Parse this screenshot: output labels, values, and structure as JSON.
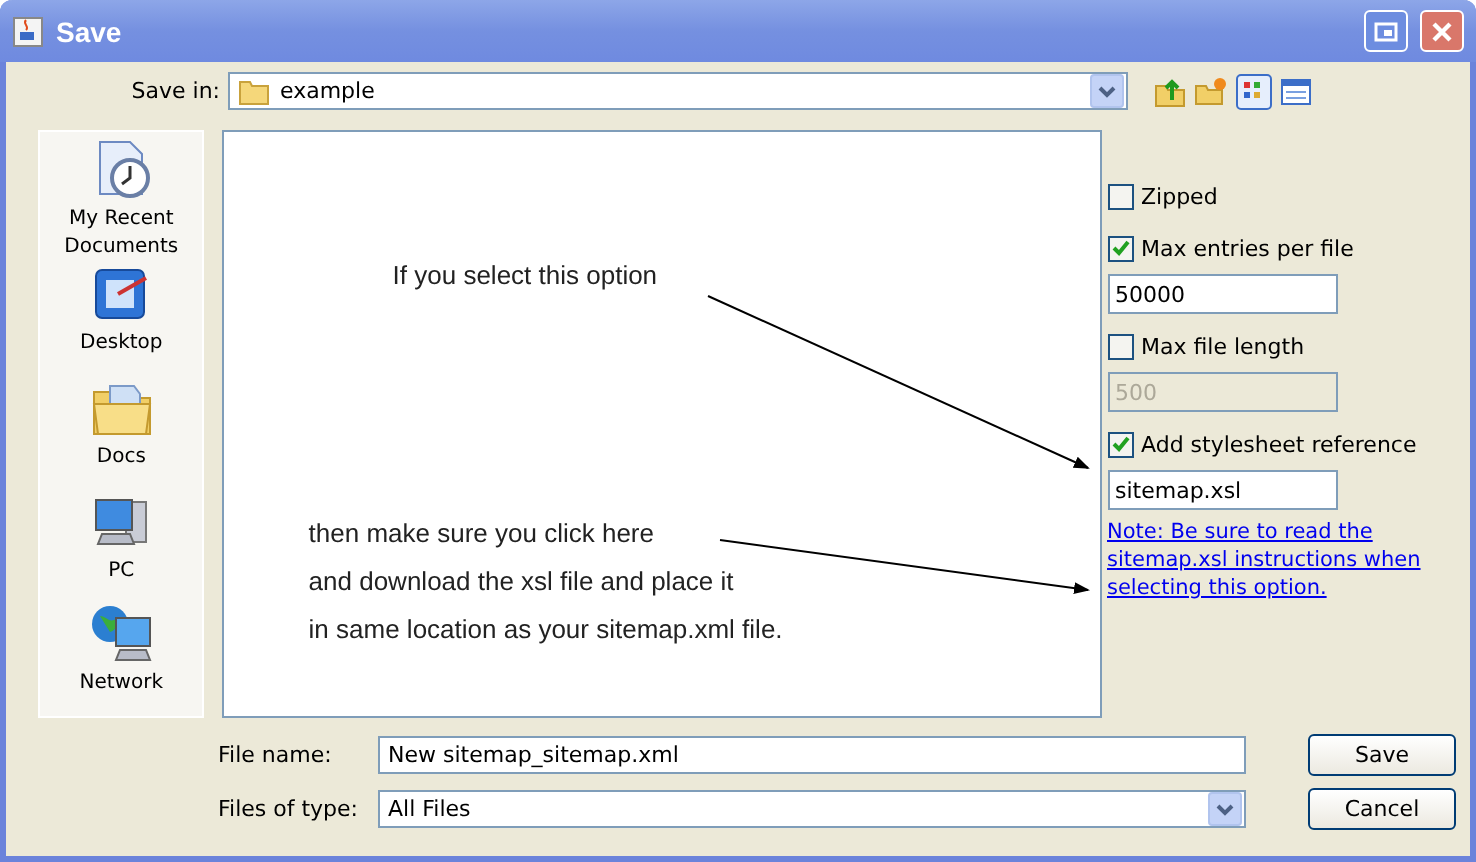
{
  "window": {
    "title": "Save"
  },
  "save_in": {
    "label": "Save in:",
    "value": "example"
  },
  "places": [
    {
      "label": "My Recent Documents",
      "kind": "recent"
    },
    {
      "label": "Desktop",
      "kind": "desktop"
    },
    {
      "label": "Docs",
      "kind": "docs"
    },
    {
      "label": "PC",
      "kind": "pc"
    },
    {
      "label": "Network",
      "kind": "network"
    }
  ],
  "annotations": [
    {
      "lines": [
        "If you select this option"
      ]
    },
    {
      "lines": [
        "then make sure you click here",
        "and download the xsl file and place it",
        "in same location as your sitemap.xml file."
      ]
    }
  ],
  "options": [
    {
      "kind": "checkbox",
      "label": "Zipped",
      "checked": false
    },
    {
      "kind": "checkbox",
      "label": "Max entries per file",
      "checked": true
    },
    {
      "kind": "field",
      "value": "50000",
      "disabled": false
    },
    {
      "kind": "checkbox",
      "label": "Max file length",
      "checked": false
    },
    {
      "kind": "field",
      "value": "500",
      "disabled": true
    },
    {
      "kind": "checkbox",
      "label": "Add stylesheet reference",
      "checked": true
    },
    {
      "kind": "field",
      "value": "sitemap.xsl",
      "disabled": false
    },
    {
      "kind": "link",
      "text": "Note: Be sure to read the sitemap.xsl instructions when selecting this option."
    }
  ],
  "file_name": {
    "label": "File name:",
    "value": "New sitemap_sitemap.xml"
  },
  "files_of_type": {
    "label": "Files of type:",
    "value": "All Files"
  },
  "buttons": [
    "Save",
    "Cancel"
  ]
}
